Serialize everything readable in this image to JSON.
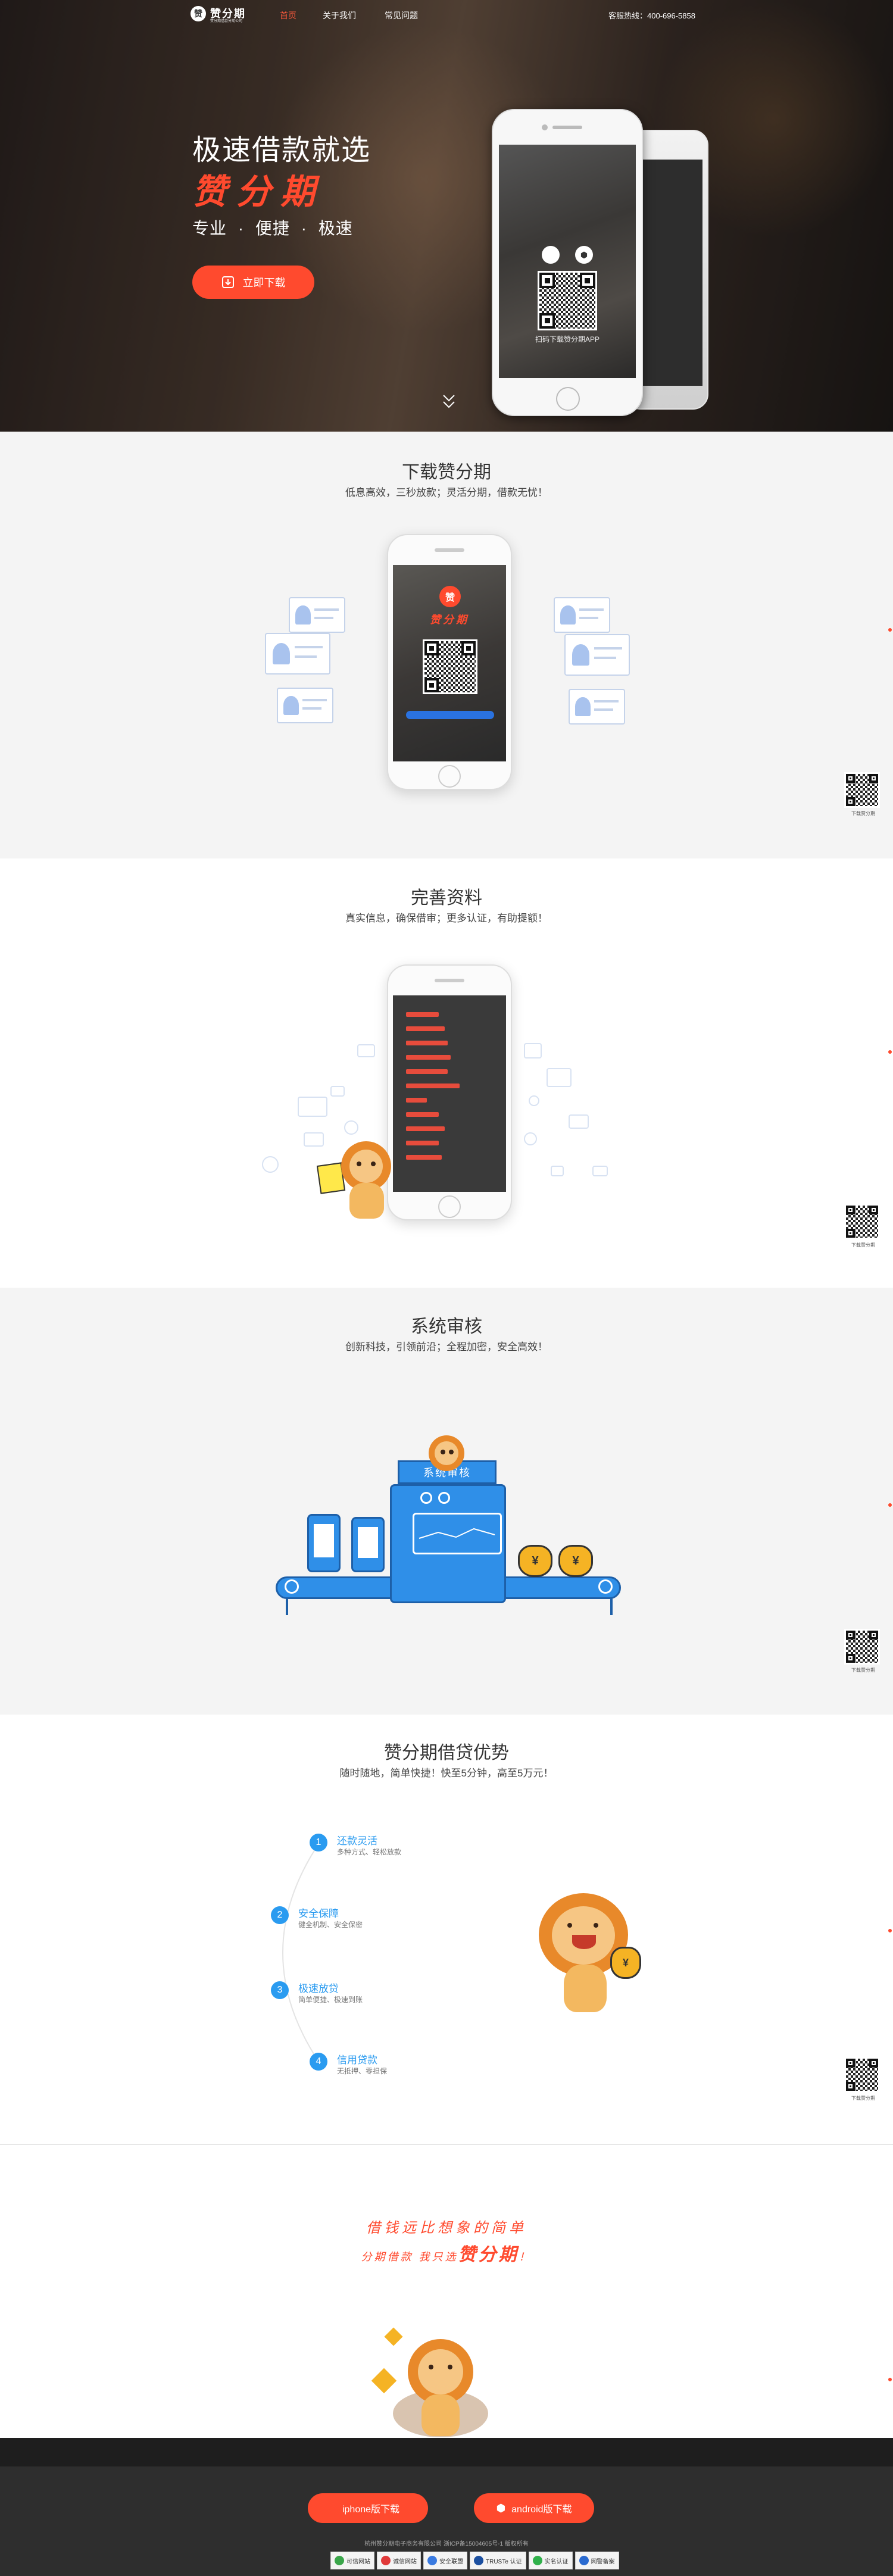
{
  "nav": {
    "logo_mark": "赞",
    "logo_text": "赞分期",
    "logo_sub": "赞分期借款分期公司",
    "items": [
      {
        "label": "首页",
        "active": true
      },
      {
        "label": "关于我们",
        "active": false
      },
      {
        "label": "常见问题",
        "active": false
      }
    ],
    "hotline": "客服热线：400-696-5858"
  },
  "hero": {
    "title": "极速借款就选",
    "brand": "赞分期",
    "tags": "专业 · 便捷 · 极速",
    "button_label": "立即下载",
    "phone_caption": "扫码下载赞分期APP",
    "apple_glyph": "",
    "android_glyph": "⬢"
  },
  "download": {
    "title": "下载赞分期",
    "subtitle": "低息高效，三秒放款；灵活分期，借款无忧！",
    "logo_mark": "赞",
    "logo_text": "赞分期"
  },
  "profile": {
    "title": "完善资料",
    "subtitle": "真实信息，确保借审；更多认证，有助提额！"
  },
  "review": {
    "title": "系统审核",
    "subtitle": "创新科技，引领前沿；全程加密，安全高效！",
    "machine_label": "系统审核",
    "coin_symbol": "¥"
  },
  "advantages": {
    "title": "赞分期借贷优势",
    "subtitle": "随时随地，简单快捷！快至5分钟，高至5万元！",
    "items": [
      {
        "num": "1",
        "title": "还款灵活",
        "desc": "多种方式、轻松放款"
      },
      {
        "num": "2",
        "title": "安全保障",
        "desc": "健全机制、安全保密"
      },
      {
        "num": "3",
        "title": "极速放贷",
        "desc": "简单便捷、极速到账"
      },
      {
        "num": "4",
        "title": "信用贷款",
        "desc": "无抵押、零担保"
      }
    ]
  },
  "slogan": {
    "line1": "借钱远比想象的简单",
    "line2_pre": "分期借款 我只选",
    "line2_brand": "赞分期",
    "line2_post": "！"
  },
  "side_qr_caption": "下载赞分期",
  "footer": {
    "iphone_label": "iphone版下载",
    "android_label": "android版下载",
    "badges": [
      "可信网站",
      "诚信网站",
      "安全联盟",
      "TRUSTe 认证",
      "实名认证",
      "网警备案"
    ],
    "copyright": "杭州赞分期电子商务有限公司 浙ICP备15004605号-1 版权所有"
  },
  "colors": {
    "accent": "#ff4a2e",
    "blue": "#2a9bf0",
    "gray_bg": "#f4f4f4",
    "footer_bg": "#2e2e2e"
  }
}
